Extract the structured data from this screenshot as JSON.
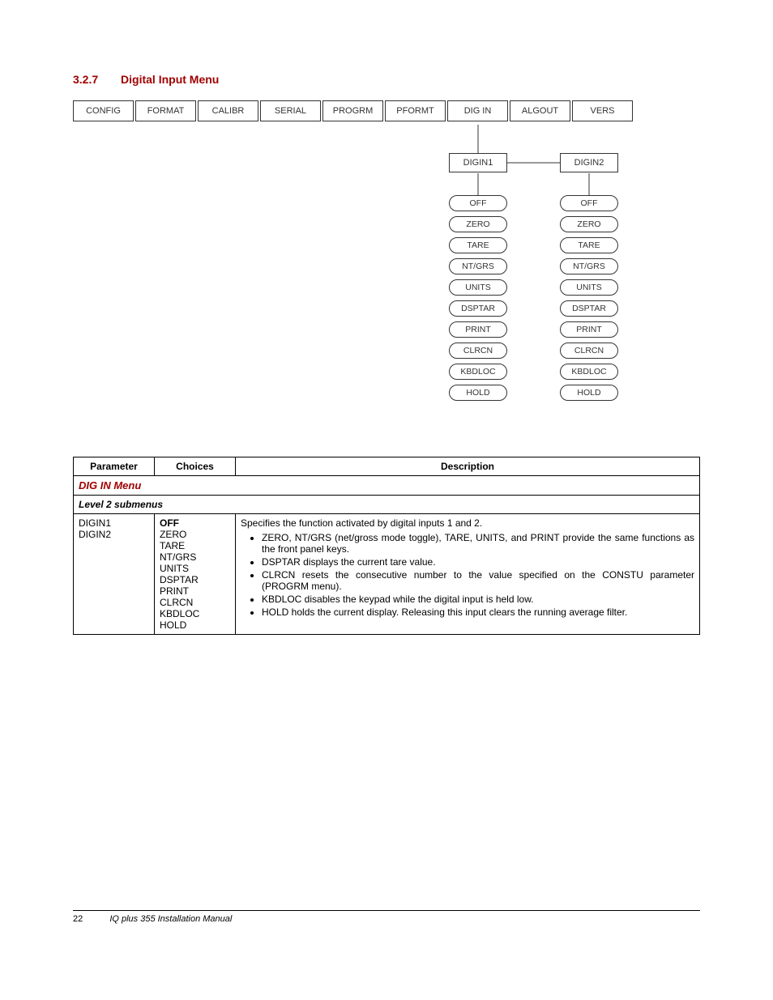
{
  "heading": {
    "number": "3.2.7",
    "title": "Digital Input Menu"
  },
  "menus": {
    "top": [
      "CONFIG",
      "FORMAT",
      "CALIBR",
      "SERIAL",
      "PROGRM",
      "PFORMT",
      "DIG IN",
      "ALGOUT",
      "VERS"
    ],
    "sub": [
      "DIGIN1",
      "DIGIN2"
    ],
    "options": [
      "OFF",
      "ZERO",
      "TARE",
      "NT/GRS",
      "UNITS",
      "DSPTAR",
      "PRINT",
      "CLRCN",
      "KBDLOC",
      "HOLD"
    ]
  },
  "table": {
    "title": "DIG IN Menu",
    "headers": {
      "param": "Parameter",
      "choices": "Choices",
      "desc": "Description"
    },
    "subhead": "Level 2 submenus",
    "row": {
      "params": [
        "DIGIN1",
        "DIGIN2"
      ],
      "choices": [
        "OFF",
        "ZERO",
        "TARE",
        "NT/GRS",
        "UNITS",
        "DSPTAR",
        "PRINT",
        "CLRCN",
        "KBDLOC",
        "HOLD"
      ],
      "desc_intro": "Specifies the function activated by digital inputs 1 and 2.",
      "bullets": [
        "ZERO, NT/GRS (net/gross mode toggle), TARE, UNITS, and PRINT provide the same functions as the front panel keys.",
        "DSPTAR displays the current tare value.",
        "CLRCN resets the consecutive number to the value specified on the CONSTU parameter (PROGRM menu).",
        "KBDLOC disables the keypad while the digital input is held low.",
        "HOLD holds the current display. Releasing this input clears the running average filter."
      ]
    }
  },
  "footer": {
    "page": "22",
    "title": "IQ plus 355 Installation Manual"
  }
}
